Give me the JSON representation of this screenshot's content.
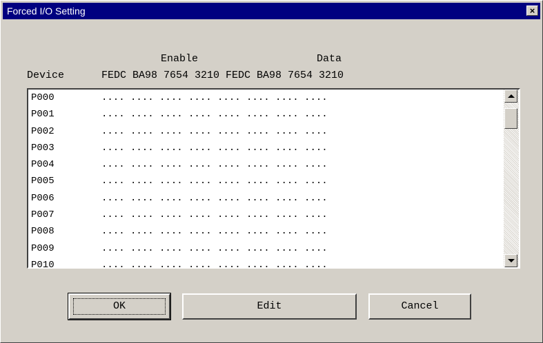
{
  "window": {
    "title": "Forced I/O Setting",
    "close_glyph": "×"
  },
  "header": {
    "enable_label": "Enable",
    "data_label": "Data",
    "device_label": "Device",
    "bit_columns": "FEDC BA98 7654 3210 FEDC BA98 7654 3210"
  },
  "rows": [
    {
      "device": "P000",
      "bits": ".... .... .... .... .... .... .... ...."
    },
    {
      "device": "P001",
      "bits": ".... .... .... .... .... .... .... ...."
    },
    {
      "device": "P002",
      "bits": ".... .... .... .... .... .... .... ...."
    },
    {
      "device": "P003",
      "bits": ".... .... .... .... .... .... .... ...."
    },
    {
      "device": "P004",
      "bits": ".... .... .... .... .... .... .... ...."
    },
    {
      "device": "P005",
      "bits": ".... .... .... .... .... .... .... ...."
    },
    {
      "device": "P006",
      "bits": ".... .... .... .... .... .... .... ...."
    },
    {
      "device": "P007",
      "bits": ".... .... .... .... .... .... .... ...."
    },
    {
      "device": "P008",
      "bits": ".... .... .... .... .... .... .... ...."
    },
    {
      "device": "P009",
      "bits": ".... .... .... .... .... .... .... ...."
    },
    {
      "device": "P010",
      "bits": ".... .... .... .... .... .... .... ...."
    }
  ],
  "buttons": {
    "ok": "OK",
    "edit": "Edit",
    "cancel": "Cancel"
  }
}
